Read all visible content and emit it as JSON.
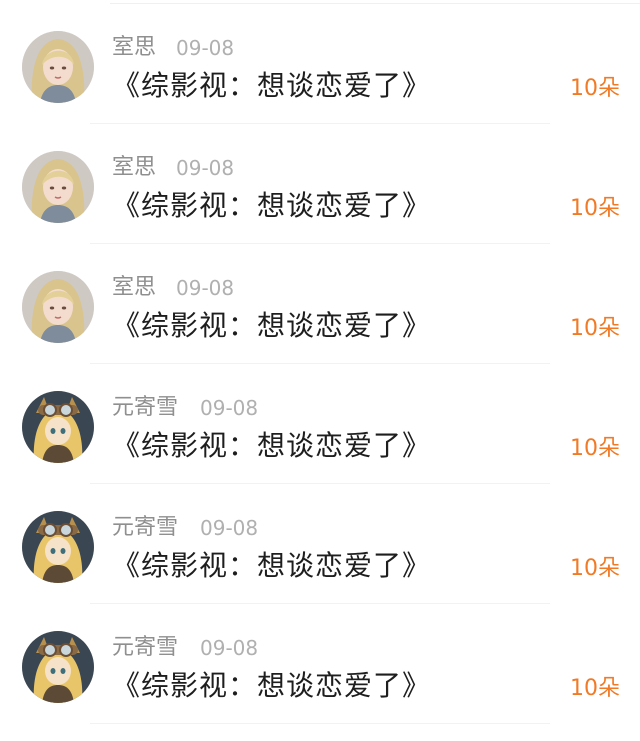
{
  "gifts": [
    {
      "user": "室思",
      "date": "09-08",
      "message": "《综影视：想谈恋爱了》",
      "amount": "10朵",
      "avatar": "blonde-girl-avatar"
    },
    {
      "user": "室思",
      "date": "09-08",
      "message": "《综影视：想谈恋爱了》",
      "amount": "10朵",
      "avatar": "blonde-girl-avatar"
    },
    {
      "user": "室思",
      "date": "09-08",
      "message": "《综影视：想谈恋爱了》",
      "amount": "10朵",
      "avatar": "blonde-girl-avatar"
    },
    {
      "user": "元寄雪",
      "date": "09-08",
      "message": "《综影视：想谈恋爱了》",
      "amount": "10朵",
      "avatar": "goggles-cat-avatar"
    },
    {
      "user": "元寄雪",
      "date": "09-08",
      "message": "《综影视：想谈恋爱了》",
      "amount": "10朵",
      "avatar": "goggles-cat-avatar"
    },
    {
      "user": "元寄雪",
      "date": "09-08",
      "message": "《综影视：想谈恋爱了》",
      "amount": "10朵",
      "avatar": "goggles-cat-avatar"
    }
  ],
  "colors": {
    "accent": "#f07a26",
    "name": "#8f8f8f",
    "date": "#b0b0b0",
    "message": "#1e1e1e"
  }
}
